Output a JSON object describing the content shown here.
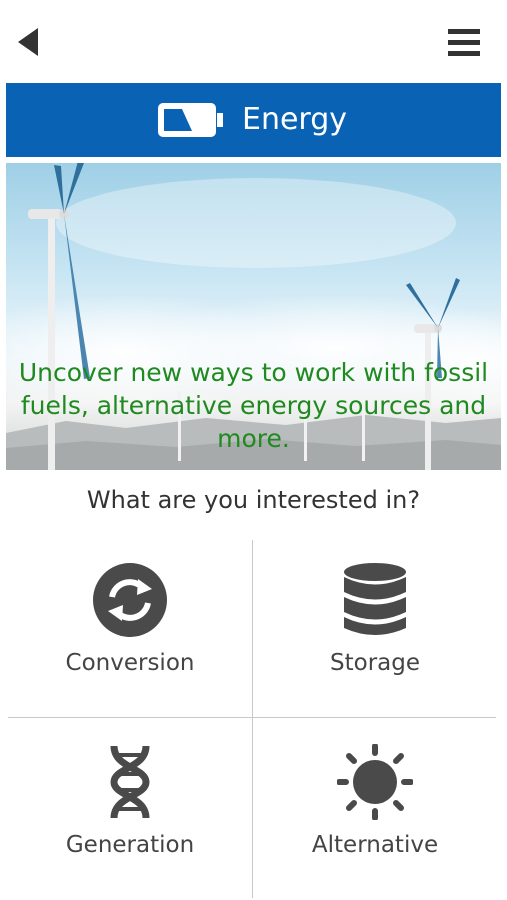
{
  "nav": {
    "back_icon": "back-arrow-icon",
    "menu_icon": "hamburger-menu-icon"
  },
  "header": {
    "title": "Energy",
    "icon": "battery-icon",
    "background_color": "#0a62b4"
  },
  "hero": {
    "caption": "Uncover new ways to work with fossil fuels, alternative energy sources and more.",
    "caption_color": "#1f8a1f",
    "image": "wind-turbines-photo"
  },
  "question": "What are you interested in?",
  "categories": [
    {
      "label": "Conversion",
      "icon": "refresh-arrows-icon"
    },
    {
      "label": "Storage",
      "icon": "database-icon"
    },
    {
      "label": "Generation",
      "icon": "dna-icon"
    },
    {
      "label": "Alternative",
      "icon": "sun-icon"
    }
  ]
}
